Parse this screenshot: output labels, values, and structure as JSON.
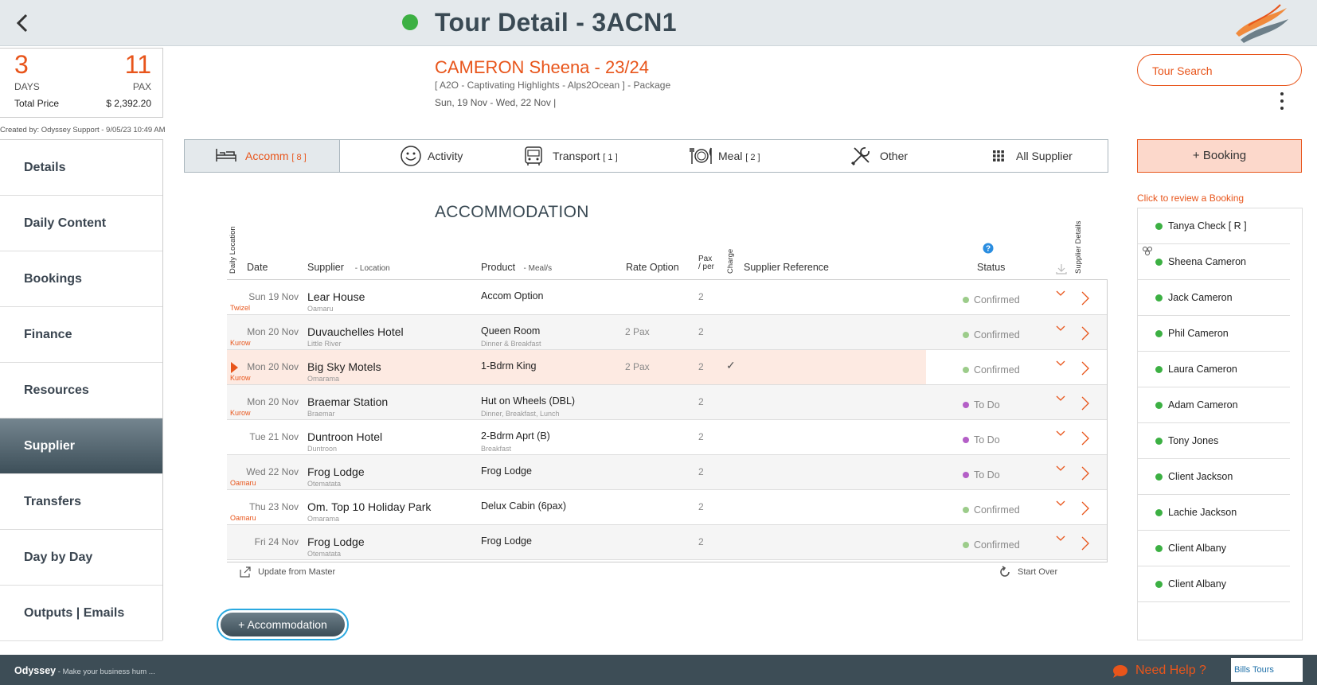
{
  "header": {
    "title": "Tour Detail - 3ACN1"
  },
  "summary": {
    "days": "3",
    "days_label": "DAYS",
    "pax": "11",
    "pax_label": "PAX",
    "total_label": "Total Price",
    "total_value": "$ 2,392.20",
    "created_by": "Created by: Odyssey Support - 9/05/23 10:49 AM"
  },
  "tour": {
    "name": "CAMERON Sheena - 23/24",
    "subtitle": "[ A2O - Captivating Highlights - Alps2Ocean ] - Package",
    "dates": "Sun, 19 Nov  - Wed, 22 Nov  |"
  },
  "right": {
    "tour_search": "Tour Search",
    "booking": "+ Booking",
    "booking_hint": "Click to review a Booking",
    "pax_list": [
      "Tanya Check  [ R ]",
      "Sheena Cameron",
      "Jack Cameron",
      "Phil Cameron",
      "Laura Cameron",
      "Adam Cameron",
      "Tony Jones",
      "Client Jackson",
      "Lachie Jackson",
      "Client Albany",
      "Client Albany"
    ]
  },
  "sidebar": {
    "items": [
      "Details",
      "Daily Content",
      "Bookings",
      "Finance",
      "Resources",
      "Supplier",
      "Transfers",
      "Day by Day",
      "Outputs | Emails"
    ]
  },
  "tabs": [
    {
      "label": "Accomm",
      "count": "[ 8 ]",
      "icon": "bed-icon"
    },
    {
      "label": "Activity",
      "count": "",
      "icon": "smiley-icon"
    },
    {
      "label": "Transport",
      "count": "[ 1 ]",
      "icon": "bus-icon"
    },
    {
      "label": "Meal",
      "count": "[ 2 ]",
      "icon": "meal-icon"
    },
    {
      "label": "Other",
      "count": "",
      "icon": "tools-icon"
    },
    {
      "label": "All Supplier",
      "count": "",
      "icon": "grid-icon"
    }
  ],
  "section_title": "ACCOMMODATION",
  "table": {
    "headers": {
      "daily_location": "Daily Location",
      "date": "Date",
      "supplier": "Supplier",
      "location": "- Location",
      "product": "Product",
      "meals": "- Meal/s",
      "rate": "Rate Option",
      "pax": "Pax",
      "per": "/ per",
      "charge": "Charge",
      "supplier_ref": "Supplier Reference",
      "status": "Status",
      "supplier_details": "Supplier Details"
    },
    "rows": [
      {
        "date": "Sun 19 Nov",
        "daily_loc": "Twizel",
        "supplier": "Lear House",
        "supplier_loc": "Oamaru",
        "product": "Accom Option",
        "meals": "",
        "rate": "",
        "pax": "2",
        "charge": "",
        "status": "Confirmed"
      },
      {
        "date": "Mon 20 Nov",
        "daily_loc": "Kurow",
        "supplier": "Duvauchelles Hotel",
        "supplier_loc": "Little River",
        "product": "Queen Room",
        "meals": "Dinner & Breakfast",
        "rate": "2 Pax",
        "pax": "2",
        "charge": "",
        "status": "Confirmed"
      },
      {
        "date": "Mon 20 Nov",
        "daily_loc": "Kurow",
        "supplier": "Big Sky Motels",
        "supplier_loc": "Omarama",
        "product": "1-Bdrm King",
        "meals": "",
        "rate": "2 Pax",
        "pax": "2",
        "charge": "✓",
        "status": "Confirmed"
      },
      {
        "date": "Mon 20 Nov",
        "daily_loc": "Kurow",
        "supplier": "Braemar Station",
        "supplier_loc": "Braemar",
        "product": "Hut on Wheels (DBL)",
        "meals": "Dinner, Breakfast, Lunch",
        "rate": "",
        "pax": "2",
        "charge": "",
        "status": "To Do"
      },
      {
        "date": "Tue 21 Nov",
        "daily_loc": "",
        "supplier": "Duntroon Hotel",
        "supplier_loc": "Duntroon",
        "product": "2-Bdrm Aprt (B)",
        "meals": "Breakfast",
        "rate": "",
        "pax": "2",
        "charge": "",
        "status": "To Do"
      },
      {
        "date": "Wed 22 Nov",
        "daily_loc": "Oamaru",
        "supplier": "Frog Lodge",
        "supplier_loc": "Otematata",
        "product": "Frog Lodge",
        "meals": "",
        "rate": "",
        "pax": "2",
        "charge": "",
        "status": "To Do"
      },
      {
        "date": "Thu 23 Nov",
        "daily_loc": "Oamaru",
        "supplier": "Om. Top 10 Holiday Park",
        "supplier_loc": "Omarama",
        "product": "Delux Cabin (6pax)",
        "meals": "",
        "rate": "",
        "pax": "2",
        "charge": "",
        "status": "Confirmed"
      },
      {
        "date": "Fri 24 Nov",
        "daily_loc": "",
        "supplier": "Frog Lodge",
        "supplier_loc": "Otematata",
        "product": "Frog Lodge",
        "meals": "",
        "rate": "",
        "pax": "2",
        "charge": "",
        "status": "Confirmed"
      }
    ]
  },
  "actions": {
    "update_master": "Update from Master",
    "start_over": "Start Over",
    "add_accommodation": "+ Accommodation"
  },
  "footer": {
    "brand": "Odyssey",
    "tagline": " - Make your business hum ...",
    "need_help": "Need Help ?",
    "partner": "Bills Tours"
  },
  "colors": {
    "accent": "#e8551b",
    "confirmed": "#9ccc8a",
    "todo": "#b45fc7",
    "online": "#3cb043",
    "footer": "#3d4d56"
  }
}
